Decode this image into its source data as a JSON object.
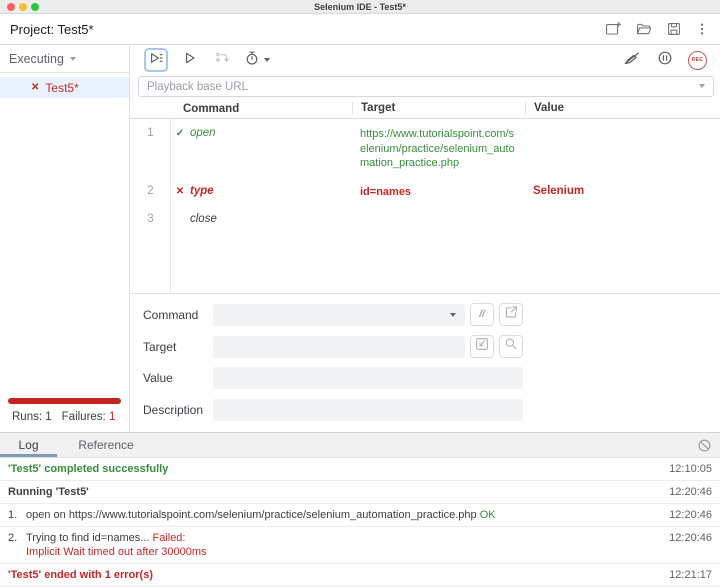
{
  "titlebar": {
    "title": "Selenium IDE - Test5*"
  },
  "project_bar": {
    "label": "Project:",
    "value": "Test5*"
  },
  "sidebar": {
    "dropdown_label": "Executing",
    "test_items": [
      {
        "label": "Test5*",
        "status": "failed"
      }
    ],
    "stats": {
      "runs_label": "Runs:",
      "runs": "1",
      "failures_label": "Failures:",
      "failures": "1"
    }
  },
  "toolbar": {
    "playback_url_placeholder": "Playback base URL",
    "rec_label": "REC"
  },
  "icons": {
    "check": "✓",
    "cross": "✕",
    "slash_button": "//"
  },
  "editor": {
    "columns": {
      "command": "Command",
      "target": "Target",
      "value": "Value"
    },
    "rows": [
      {
        "num": "1",
        "status": "passed",
        "status_glyph": "✓",
        "command": "open",
        "target": "https://www.tutorialspoint.com/selenium/practice/selenium_automation_practice.php",
        "value": ""
      },
      {
        "num": "2",
        "status": "failed",
        "status_glyph": "✕",
        "command": "type",
        "target": "id=names",
        "value": "Selenium"
      },
      {
        "num": "3",
        "status": "none",
        "status_glyph": "",
        "command": "close",
        "target": "",
        "value": ""
      }
    ],
    "form": {
      "command_label": "Command",
      "target_label": "Target",
      "value_label": "Value",
      "description_label": "Description"
    }
  },
  "log_panel": {
    "tabs": [
      {
        "label": "Log",
        "active": true
      },
      {
        "label": "Reference",
        "active": false
      }
    ],
    "entries": [
      {
        "message": "'Test5' completed successfully",
        "time": "12:10:05",
        "style": "success"
      },
      {
        "message": "Running 'Test5'",
        "time": "12:20:46",
        "style": "bold"
      },
      {
        "num": "1.",
        "message": "open on https://www.tutorialspoint.com/selenium/practice/selenium_automation_practice.php",
        "status_suffix": "OK",
        "time": "12:20:46"
      },
      {
        "num": "2.",
        "message": "Trying to find id=names...",
        "status_suffix": "Failed:",
        "detail": "Implicit Wait timed out after 30000ms",
        "time": "12:20:46"
      },
      {
        "message": "'Test5' ended with 1 error(s)",
        "time": "12:21:17",
        "style": "error"
      }
    ]
  },
  "colors": {
    "success_green": "#388e3c",
    "failure_red": "#c62828",
    "progress_red": "#c1251c",
    "tab_accent_blue": "#7d9cbd",
    "focus_border_blue": "#a9c7e8"
  }
}
